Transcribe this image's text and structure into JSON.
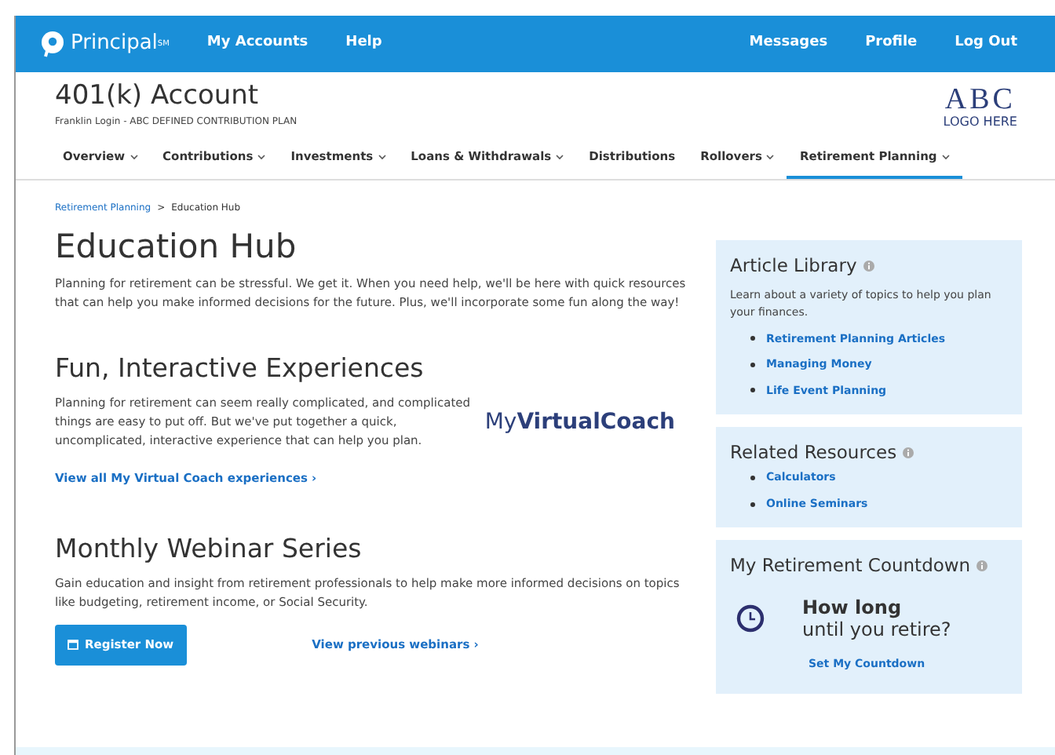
{
  "top_nav": {
    "brand": "Principal$^{SM}$",
    "links": [
      "My Accounts",
      "Help"
    ],
    "right_links": [
      "Messages",
      "Profile",
      "Log Out"
    ]
  },
  "header": {
    "title": "401(k) Account",
    "subtitle": "Franklin Login - ABC DEFINED CONTRIBUTION PLAN",
    "logo_main": "ABC",
    "logo_sub": "LOGO HERE"
  },
  "tabs": [
    {
      "label": "Overview",
      "dropdown": true,
      "selected": false
    },
    {
      "label": "Contributions",
      "dropdown": true,
      "selected": false
    },
    {
      "label": "Investments",
      "dropdown": true,
      "selected": false
    },
    {
      "label": "Loans & Withdrawals",
      "dropdown": true,
      "selected": false
    },
    {
      "label": "Distributions",
      "dropdown": false,
      "selected": false
    },
    {
      "label": "Rollovers",
      "dropdown": true,
      "selected": false
    },
    {
      "label": "Retirement Planning",
      "dropdown": true,
      "selected": true
    }
  ],
  "breadcrumb": {
    "parent": "Retirement Planning",
    "separator": ">",
    "current": "Education Hub"
  },
  "page_title": "Education Hub",
  "intro": "Planning for retirement can be stressful. We get it. When you need help, we'll be here with quick resources that can help you make informed decisions for the future. Plus, we'll incorporate some fun along the way!",
  "sections": [
    {
      "kind": "coach",
      "title": "Fun, Interactive Experiences",
      "text": "Planning for retirement can seem really complicated, and complicated things are easy to put off. But we've put together a quick, uncomplicated, interactive experience that can help you plan.",
      "logo": "My**VirtualCoach**",
      "link": "View all My Virtual Coach experiences ›"
    },
    {
      "kind": "webinar",
      "title": "Monthly Webinar Series",
      "text": "Gain education and insight from retirement professionals to help make more informed decisions on topics like budgeting, retirement income, or Social Security.",
      "button": "Register Now",
      "link": "View previous webinars ›"
    }
  ],
  "sidebar": [
    {
      "kind": "links",
      "title": "Article Library",
      "text": "Learn about a variety of topics to help you plan your finances.",
      "links": [
        "Retirement Planning Articles",
        "Managing Money",
        "Life Event Planning"
      ]
    },
    {
      "kind": "links",
      "title": "Related Resources",
      "links": [
        "Calculators",
        "Online Seminars"
      ]
    },
    {
      "kind": "countdown",
      "title": "My Retirement Countdown",
      "question_bold": "How long",
      "question": "until you retire?",
      "link": "Set My Countdown"
    }
  ]
}
